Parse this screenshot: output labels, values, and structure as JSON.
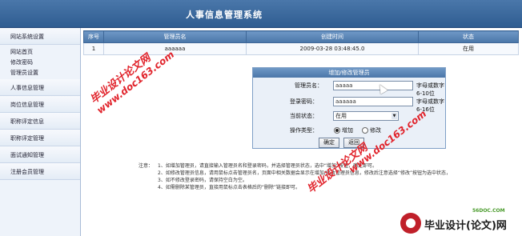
{
  "app": {
    "title": "人事信息管理系统"
  },
  "sidebar": {
    "groups": [
      {
        "label": "网站系统设置",
        "sub": [
          "网站首页",
          "修改密码",
          "管理员设置"
        ]
      },
      {
        "label": "人事信息管理"
      },
      {
        "label": "岗位信息管理"
      },
      {
        "label": "职称评定信息"
      },
      {
        "label": "职称评定管理"
      },
      {
        "label": "面试通知管理"
      },
      {
        "label": "注册会员管理"
      }
    ]
  },
  "table": {
    "headers": [
      "序号",
      "管理员名",
      "创建时间",
      "状态"
    ],
    "rows": [
      [
        "1",
        "aaaaaa",
        "2009-03-28 03:48:45.0",
        "在用"
      ]
    ]
  },
  "form": {
    "title": "增加/修改管理员",
    "username_label": "管理员名：",
    "username_value": "aaaaa",
    "username_hint": "字母或数字6-10位",
    "password_label": "登录密码：",
    "password_value": "aaaaaa",
    "password_hint": "字母或数字6-16位",
    "status_label": "当前状态：",
    "status_value": "在用",
    "op_label": "操作类型：",
    "op_add": "增加",
    "op_edit": "修改",
    "submit": "确定",
    "cancel": "返回"
  },
  "notes": {
    "prefix": "注意：",
    "items": [
      "1、如增加管理员，请直接输入管理员名和登录密码，并选择管理员状态，选中“增加”按钮，确定即可。",
      "2、如修改管理员信息，请用鼠标点击管理员名，页面中相关数据会显示在增加/修改管理员信息，修改后注意选择“修改”按钮为选中状态，",
      "3、如不修改登录密码，请保持空白为空。",
      "4、如需删除某管理员，直接用鼠标点击表格后的“删除”链接即可。"
    ]
  },
  "watermarks": {
    "site1": "www.doc163.com",
    "school1": "毕业设计论文网",
    "site2": "www.doc163.com",
    "school2": "毕业设计论文网"
  },
  "corner_logo": {
    "small": "56DOC.COM",
    "text": "毕业设计(论文)网"
  }
}
